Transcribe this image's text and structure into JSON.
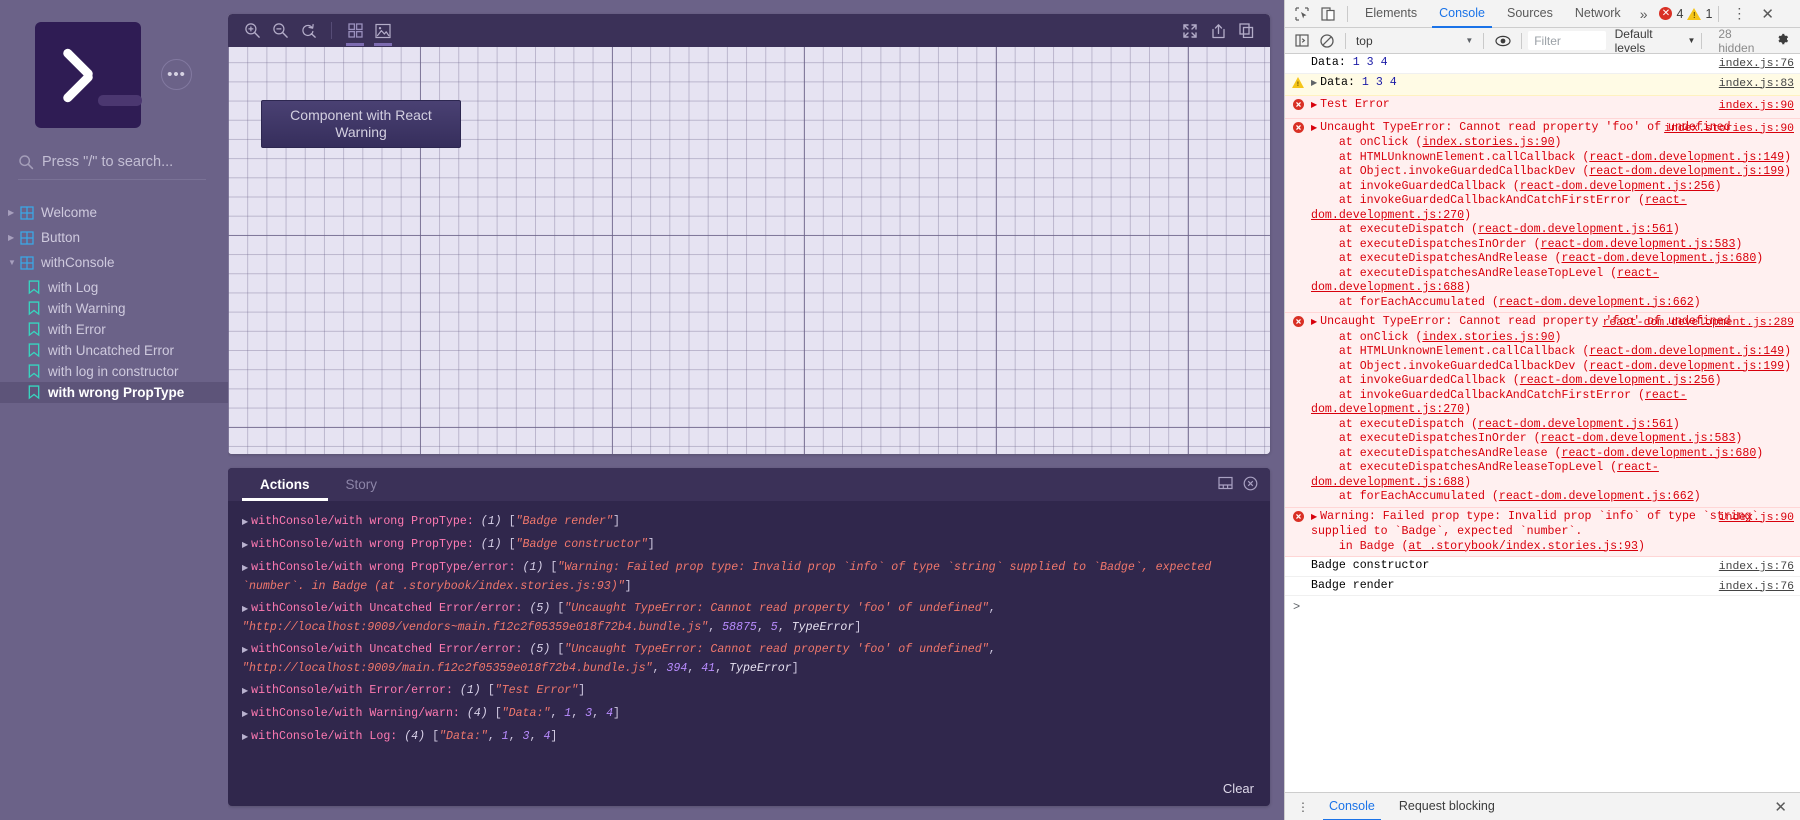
{
  "storybook": {
    "sidebar": {
      "search_placeholder": "Press \"/\" to search...",
      "menu_icon": "ellipsis-icon",
      "logo_icon": "storybook-terminal-logo",
      "tree": [
        {
          "label": "Welcome",
          "type": "root",
          "expanded": false,
          "selected": false
        },
        {
          "label": "Button",
          "type": "root",
          "expanded": false,
          "selected": false
        },
        {
          "label": "withConsole",
          "type": "root",
          "expanded": true,
          "selected": false
        },
        {
          "label": "with Log",
          "type": "leaf",
          "selected": false
        },
        {
          "label": "with Warning",
          "type": "leaf",
          "selected": false
        },
        {
          "label": "with Error",
          "type": "leaf",
          "selected": false
        },
        {
          "label": "with Uncatched Error",
          "type": "leaf",
          "selected": false
        },
        {
          "label": "with log in constructor",
          "type": "leaf",
          "selected": false
        },
        {
          "label": "with wrong PropType",
          "type": "leaf",
          "selected": true
        }
      ]
    },
    "preview_toolbar": {
      "zoom_in": "zoom-in-icon",
      "zoom_out": "zoom-out-icon",
      "zoom_reset": "zoom-reset-icon",
      "grid": "grid-background-icon",
      "background": "image-background-icon",
      "fullscreen": "fullscreen-icon",
      "open_new_tab": "open-in-new-tab-icon",
      "copy_link": "copy-link-icon"
    },
    "canvas": {
      "component_label": "Component with React Warning"
    },
    "panel": {
      "tabs": [
        {
          "label": "Actions",
          "active": true
        },
        {
          "label": "Story",
          "active": false
        }
      ],
      "clear_label": "Clear",
      "dock_icon": "dock-bottom-icon",
      "close_icon": "close-circle-icon",
      "actions": [
        {
          "name": "withConsole/with wrong PropType",
          "count": "(1)",
          "parts": [
            {
              "t": "[",
              "k": "brk"
            },
            {
              "t": "\"Badge render\"",
              "k": "str"
            },
            {
              "t": "]",
              "k": "brk"
            }
          ]
        },
        {
          "name": "withConsole/with wrong PropType",
          "count": "(1)",
          "parts": [
            {
              "t": "[",
              "k": "brk"
            },
            {
              "t": "\"Badge constructor\"",
              "k": "str"
            },
            {
              "t": "]",
              "k": "brk"
            }
          ]
        },
        {
          "name": "withConsole/with wrong PropType/error",
          "count": "(1)",
          "parts": [
            {
              "t": "[",
              "k": "brk"
            },
            {
              "t": "\"Warning: Failed prop type: Invalid prop `info` of type `string` supplied to `Badge`, expected `number`. in Badge (at .storybook/index.stories.js:93)\"",
              "k": "str"
            },
            {
              "t": "]",
              "k": "brk"
            }
          ]
        },
        {
          "name": "withConsole/with Uncatched Error/error",
          "count": "(5)",
          "parts": [
            {
              "t": "[",
              "k": "brk"
            },
            {
              "t": "\"Uncaught TypeError: Cannot read property 'foo' of undefined\"",
              "k": "str"
            },
            {
              "t": ", ",
              "k": "brk"
            },
            {
              "t": "\"http://localhost:9009/vendors~main.f12c2f05359e018f72b4.bundle.js\"",
              "k": "str"
            },
            {
              "t": ", ",
              "k": "brk"
            },
            {
              "t": "58875",
              "k": "num"
            },
            {
              "t": ", ",
              "k": "brk"
            },
            {
              "t": "5",
              "k": "num"
            },
            {
              "t": ", ",
              "k": "brk"
            },
            {
              "t": "TypeError",
              "k": "plain"
            },
            {
              "t": "]",
              "k": "brk"
            }
          ]
        },
        {
          "name": "withConsole/with Uncatched Error/error",
          "count": "(5)",
          "parts": [
            {
              "t": "[",
              "k": "brk"
            },
            {
              "t": "\"Uncaught TypeError: Cannot read property 'foo' of undefined\"",
              "k": "str"
            },
            {
              "t": ", ",
              "k": "brk"
            },
            {
              "t": "\"http://localhost:9009/main.f12c2f05359e018f72b4.bundle.js\"",
              "k": "str"
            },
            {
              "t": ", ",
              "k": "brk"
            },
            {
              "t": "394",
              "k": "num"
            },
            {
              "t": ", ",
              "k": "brk"
            },
            {
              "t": "41",
              "k": "num"
            },
            {
              "t": ", ",
              "k": "brk"
            },
            {
              "t": "TypeError",
              "k": "plain"
            },
            {
              "t": "]",
              "k": "brk"
            }
          ]
        },
        {
          "name": "withConsole/with Error/error",
          "count": "(1)",
          "parts": [
            {
              "t": "[",
              "k": "brk"
            },
            {
              "t": "\"Test Error\"",
              "k": "str"
            },
            {
              "t": "]",
              "k": "brk"
            }
          ]
        },
        {
          "name": "withConsole/with Warning/warn",
          "count": "(4)",
          "parts": [
            {
              "t": "[",
              "k": "brk"
            },
            {
              "t": "\"Data:\"",
              "k": "str"
            },
            {
              "t": ", ",
              "k": "brk"
            },
            {
              "t": "1",
              "k": "num"
            },
            {
              "t": ", ",
              "k": "brk"
            },
            {
              "t": "3",
              "k": "num"
            },
            {
              "t": ", ",
              "k": "brk"
            },
            {
              "t": "4",
              "k": "num"
            },
            {
              "t": "]",
              "k": "brk"
            }
          ]
        },
        {
          "name": "withConsole/with Log",
          "count": "(4)",
          "parts": [
            {
              "t": "[",
              "k": "brk"
            },
            {
              "t": "\"Data:\"",
              "k": "str"
            },
            {
              "t": ", ",
              "k": "brk"
            },
            {
              "t": "1",
              "k": "num"
            },
            {
              "t": ", ",
              "k": "brk"
            },
            {
              "t": "3",
              "k": "num"
            },
            {
              "t": ", ",
              "k": "brk"
            },
            {
              "t": "4",
              "k": "num"
            },
            {
              "t": "]",
              "k": "brk"
            }
          ]
        }
      ]
    }
  },
  "devtools": {
    "toolbar": {
      "inspect_icon": "inspect-element-icon",
      "device_icon": "toggle-device-toolbar-icon",
      "tabs": [
        {
          "label": "Elements",
          "active": false
        },
        {
          "label": "Console",
          "active": true
        },
        {
          "label": "Sources",
          "active": false
        },
        {
          "label": "Network",
          "active": false
        }
      ],
      "more_tabs": "»",
      "error_count": "4",
      "warning_count": "1",
      "kebab": "more-options-icon",
      "close": "close-devtools-icon"
    },
    "subbar": {
      "sidebar_toggle_icon": "console-sidebar-icon",
      "clear_console_icon": "clear-console-icon",
      "context": "top",
      "eye_icon": "live-expression-icon",
      "filter_placeholder": "Filter",
      "levels": "Default levels",
      "hidden": "28 hidden",
      "settings_icon": "settings-gear-icon"
    },
    "messages": [
      {
        "level": "log",
        "expandable": false,
        "text": "Data: ",
        "nums": "1 3 4",
        "source": "index.js:76"
      },
      {
        "level": "warn",
        "expandable": true,
        "text": "Data: ",
        "nums": "1 3 4",
        "source": "index.js:83"
      },
      {
        "level": "err",
        "expandable": true,
        "text": "Test Error",
        "nums": "",
        "source": "index.js:90"
      },
      {
        "level": "err",
        "expandable": true,
        "text": "Uncaught TypeError: Cannot read property 'foo' of undefined",
        "source": "index.stories.js:90",
        "stack": [
          "    at onClick (index.stories.js:90)",
          "    at HTMLUnknownElement.callCallback (react-dom.development.js:149)",
          "    at Object.invokeGuardedCallbackDev (react-dom.development.js:199)",
          "    at invokeGuardedCallback (react-dom.development.js:256)",
          "    at invokeGuardedCallbackAndCatchFirstError (react-dom.development.js:270)",
          "    at executeDispatch (react-dom.development.js:561)",
          "    at executeDispatchesInOrder (react-dom.development.js:583)",
          "    at executeDispatchesAndRelease (react-dom.development.js:680)",
          "    at executeDispatchesAndReleaseTopLevel (react-dom.development.js:688)",
          "    at forEachAccumulated (react-dom.development.js:662)"
        ]
      },
      {
        "level": "err",
        "expandable": true,
        "text": "Uncaught TypeError: Cannot read property 'foo' of undefined",
        "source": "react-dom.development.js:289",
        "stack": [
          "    at onClick (index.stories.js:90)",
          "    at HTMLUnknownElement.callCallback (react-dom.development.js:149)",
          "    at Object.invokeGuardedCallbackDev (react-dom.development.js:199)",
          "    at invokeGuardedCallback (react-dom.development.js:256)",
          "    at invokeGuardedCallbackAndCatchFirstError (react-dom.development.js:270)",
          "    at executeDispatch (react-dom.development.js:561)",
          "    at executeDispatchesInOrder (react-dom.development.js:583)",
          "    at executeDispatchesAndRelease (react-dom.development.js:680)",
          "    at executeDispatchesAndReleaseTopLevel (react-dom.development.js:688)",
          "    at forEachAccumulated (react-dom.development.js:662)"
        ]
      },
      {
        "level": "err",
        "expandable": true,
        "text": "Warning: Failed prop type: Invalid prop `info` of type `string` supplied to `Badge`, expected `number`.",
        "source": "index.js:90",
        "stack": [
          "    in Badge (at .storybook/index.stories.js:93)"
        ]
      },
      {
        "level": "log",
        "expandable": false,
        "text": "Badge constructor",
        "source": "index.js:76"
      },
      {
        "level": "log",
        "expandable": false,
        "text": "Badge render",
        "source": "index.js:76"
      }
    ],
    "prompt": ">",
    "bottom": {
      "tabs": [
        {
          "label": "Console",
          "active": true
        },
        {
          "label": "Request blocking",
          "active": false
        }
      ],
      "drawer_menu_icon": "drawer-more-icon",
      "close_icon": "close-drawer-icon"
    }
  },
  "colors": {
    "sb_bg": "#6b6288",
    "sb_panel": "#30274c",
    "sb_toolbar": "#3b3158",
    "accent_blue": "#1a73e8",
    "error_red": "#d8000c",
    "warn_yellow": "#f5c518"
  }
}
